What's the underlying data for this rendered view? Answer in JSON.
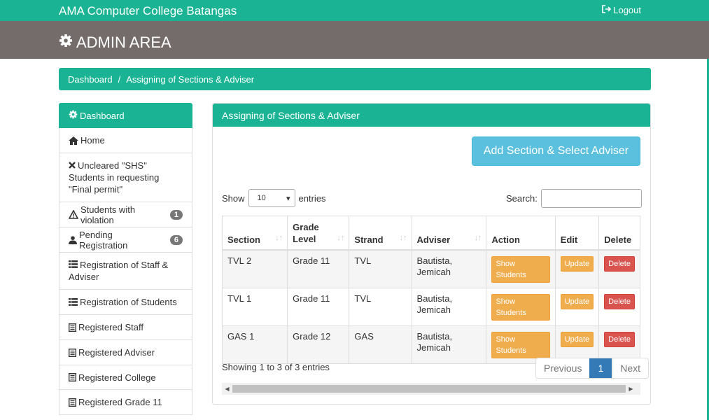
{
  "header": {
    "brand": "AMA Computer College Batangas",
    "logout": "Logout",
    "admin_title": "ADMIN AREA"
  },
  "breadcrumb": [
    "Dashboard",
    "Assigning of Sections & Adviser"
  ],
  "sidebar": {
    "head": "Dashboard",
    "items": [
      {
        "label": "Home",
        "icon": "home-icon"
      },
      {
        "label": "Uncleared \"SHS\" Students in requesting \"Final permit\"",
        "icon": "x-icon"
      },
      {
        "label": "Students with violation",
        "icon": "warning-icon",
        "badge": "1"
      },
      {
        "label": "Pending Registration",
        "icon": "user-icon",
        "badge": "6"
      },
      {
        "label": "Registration of Staff & Adviser",
        "icon": "list-icon"
      },
      {
        "label": "Registration of Students",
        "icon": "list-icon"
      },
      {
        "label": "Registered Staff",
        "icon": "document-icon"
      },
      {
        "label": "Registered Adviser",
        "icon": "document-icon"
      },
      {
        "label": "Registered College",
        "icon": "document-icon"
      },
      {
        "label": "Registered Grade 11",
        "icon": "document-icon"
      }
    ]
  },
  "panel": {
    "title": "Assigning of Sections & Adviser",
    "add_button": "Add Section & Select Adviser",
    "show_label": "Show",
    "entries_label": "entries",
    "page_size": "10",
    "search_label": "Search:"
  },
  "table": {
    "headers": [
      "Section",
      "Grade Level",
      "Strand",
      "Adviser",
      "Action",
      "Edit",
      "Delete"
    ],
    "action_label": "Show Students",
    "edit_label": "Update",
    "delete_label": "Delete",
    "rows": [
      {
        "section": "TVL 2",
        "grade": "Grade 11",
        "strand": "TVL",
        "adviser": "Bautista, Jemicah"
      },
      {
        "section": "TVL 1",
        "grade": "Grade 11",
        "strand": "TVL",
        "adviser": "Bautista, Jemicah"
      },
      {
        "section": "GAS 1",
        "grade": "Grade 12",
        "strand": "GAS",
        "adviser": "Bautista, Jemicah"
      }
    ]
  },
  "footer": {
    "info": "Showing 1 to 3 of 3 entries",
    "previous": "Previous",
    "page": "1",
    "next": "Next"
  }
}
